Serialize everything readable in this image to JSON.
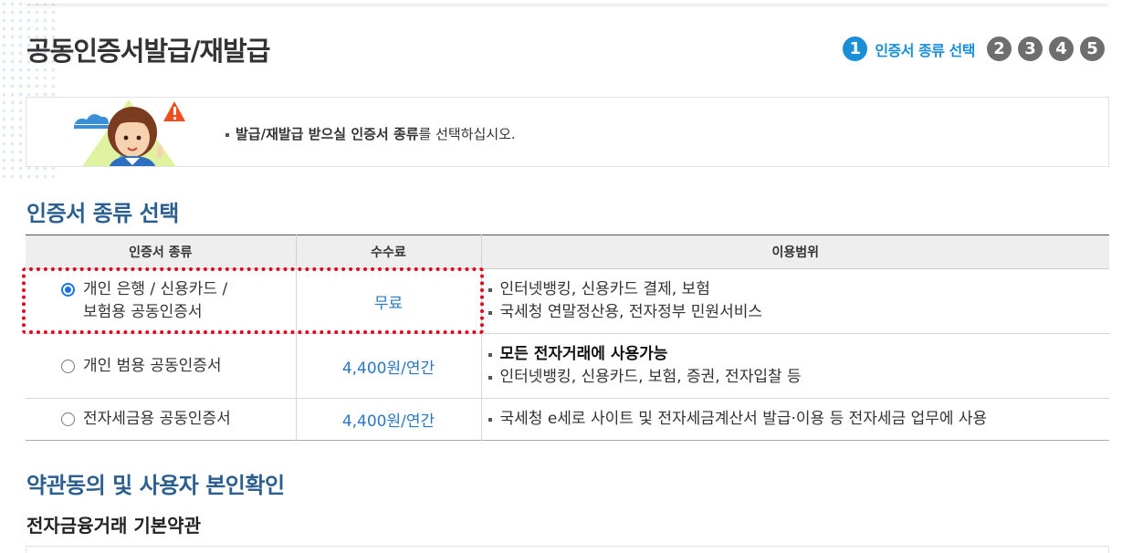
{
  "page": {
    "title": "공동인증서발급/재발급"
  },
  "steps": {
    "active_number": "1",
    "active_label": "인증서 종류 선택",
    "others": [
      "2",
      "3",
      "4",
      "5"
    ]
  },
  "notice": {
    "text_bold": "발급/재발급 받으실 인증서 종류",
    "text_rest": "를 선택하십시오."
  },
  "cert_section": {
    "title": "인증서 종류 선택",
    "headers": {
      "type": "인증서 종류",
      "fee": "수수료",
      "use": "이용범위"
    },
    "rows": [
      {
        "type_line1": "개인 은행 / 신용카드 /",
        "type_line2": "보험용 공동인증서",
        "fee": "무료",
        "use1": "인터넷뱅킹, 신용카드 결제, 보험",
        "use2": "국세청 연말정산용, 전자정부 민원서비스",
        "selected": true
      },
      {
        "type_line1": "개인 범용 공동인증서",
        "fee": "4,400원/연간",
        "use1": "모든 전자거래에 사용가능",
        "use2": "인터넷뱅킹, 신용카드, 보험, 증권, 전자입찰 등",
        "selected": false
      },
      {
        "type_line1": "전자세금용 공동인증서",
        "fee": "4,400원/연간",
        "use1": "국세청 e세로 사이트 및 전자세금계산서 발급·이용 등 전자세금 업무에 사용",
        "selected": false
      }
    ]
  },
  "terms_section": {
    "title": "약관동의 및 사용자 본인확인",
    "subtitle": "전자금융거래 기본약관"
  },
  "colors": {
    "accent": "#1a8fd8",
    "section_title": "#2c5f8e",
    "fee_text": "#2a78c4",
    "highlight": "#e3001b",
    "step_inactive": "#6e6e6e"
  }
}
